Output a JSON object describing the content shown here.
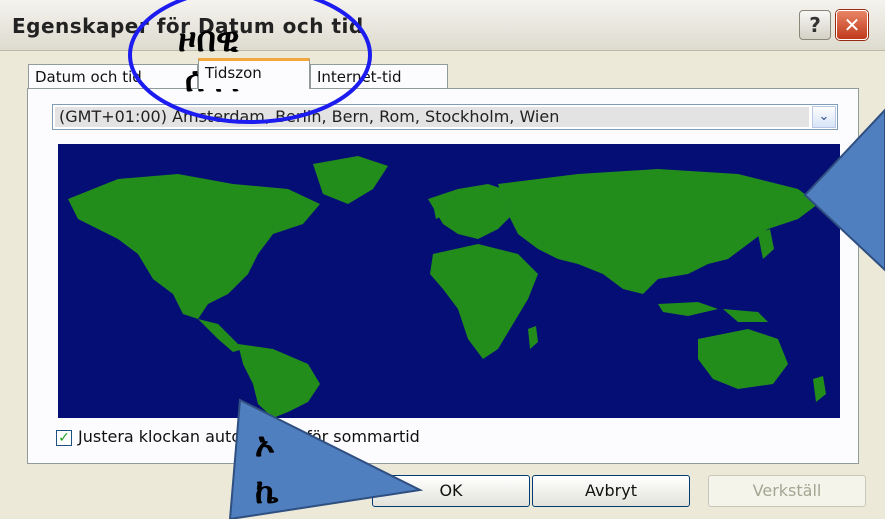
{
  "window": {
    "title": "Egenskaper för Datum och tid",
    "help_label": "?",
    "close_label": "✕"
  },
  "tabs": [
    {
      "label": "Datum och tid"
    },
    {
      "label": "Tidszon"
    },
    {
      "label": "Internet-tid"
    }
  ],
  "timezone": {
    "selected": "(GMT+01:00) Amsterdam, Berlin, Bern, Rom, Stockholm, Wien",
    "dropdown_glyph": "⌄"
  },
  "dst": {
    "checked": true,
    "check_glyph": "✓",
    "label": "Justera klockan automatiskt för sommartid"
  },
  "buttons": {
    "ok": "OK",
    "cancel": "Avbryt",
    "apply": "Verkställ"
  },
  "annotations": {
    "circle_line1": "ዞበዊ",
    "circle_line2": "ሰዓት",
    "arrow_line1": "ኦ",
    "arrow_line2": "ኬ"
  },
  "colors": {
    "ocean": "#040e74",
    "land": "#238d1c",
    "annotation_blue": "#4f7fbf",
    "circle_stroke": "#1c1cf0"
  }
}
